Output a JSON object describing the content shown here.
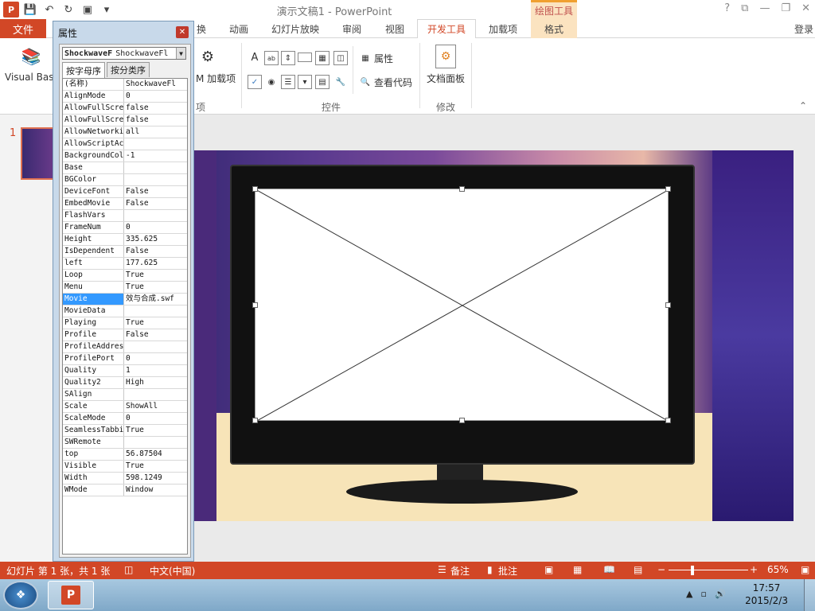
{
  "app": {
    "title": "演示文稿1 - PowerPoint",
    "context_tool": "绘图工具",
    "login": "登录",
    "window_controls": [
      "?",
      "⧉",
      "—",
      "❐",
      "✕"
    ]
  },
  "tabs": [
    {
      "label": "文件",
      "name": "file"
    },
    {
      "label": "换",
      "name": "transitions"
    },
    {
      "label": "动画",
      "name": "animations"
    },
    {
      "label": "幻灯片放映",
      "name": "slideshow"
    },
    {
      "label": "审阅",
      "name": "review"
    },
    {
      "label": "视图",
      "name": "view"
    },
    {
      "label": "开发工具",
      "name": "developer"
    },
    {
      "label": "加载项",
      "name": "addins"
    },
    {
      "label": "格式",
      "name": "format"
    }
  ],
  "ribbon": {
    "visual_basic": "Visual Bas",
    "addins_btn": "M 加载项",
    "group_addins_label": "项",
    "properties_btn": "属性",
    "view_code_btn": "查看代码",
    "group_controls_label": "控件",
    "doc_panel_btn": "文档面板",
    "group_modify_label": "修改"
  },
  "slides_panel": {
    "slide_number": "1"
  },
  "properties_window": {
    "title": "属性",
    "object_name": "ShockwaveF",
    "object_type": "ShockwaveFl",
    "tabs": [
      "按字母序",
      "按分类序"
    ],
    "rows": [
      [
        "(名称)",
        "ShockwaveFl"
      ],
      [
        "AlignMode",
        "0"
      ],
      [
        "AllowFullScre",
        "false"
      ],
      [
        "AllowFullScre",
        "false"
      ],
      [
        "AllowNetworki",
        "all"
      ],
      [
        "AllowScriptAc",
        ""
      ],
      [
        "BackgroundCol",
        "-1"
      ],
      [
        "Base",
        ""
      ],
      [
        "BGColor",
        ""
      ],
      [
        "DeviceFont",
        "False"
      ],
      [
        "EmbedMovie",
        "False"
      ],
      [
        "FlashVars",
        ""
      ],
      [
        "FrameNum",
        "0"
      ],
      [
        "Height",
        "335.625"
      ],
      [
        "IsDependent",
        "False"
      ],
      [
        "left",
        "177.625"
      ],
      [
        "Loop",
        "True"
      ],
      [
        "Menu",
        "True"
      ],
      [
        "Movie",
        "效与合成.swf"
      ],
      [
        "MovieData",
        ""
      ],
      [
        "Playing",
        "True"
      ],
      [
        "Profile",
        "False"
      ],
      [
        "ProfileAddres",
        ""
      ],
      [
        "ProfilePort",
        "0"
      ],
      [
        "Quality",
        "1"
      ],
      [
        "Quality2",
        "High"
      ],
      [
        "SAlign",
        ""
      ],
      [
        "Scale",
        "ShowAll"
      ],
      [
        "ScaleMode",
        "0"
      ],
      [
        "SeamlessTabbi",
        "True"
      ],
      [
        "SWRemote",
        ""
      ],
      [
        "top",
        "56.87504"
      ],
      [
        "Visible",
        "True"
      ],
      [
        "Width",
        "598.1249"
      ],
      [
        "WMode",
        "Window"
      ]
    ],
    "selected_row": "Movie"
  },
  "status": {
    "slide_info": "幻灯片 第 1 张，共 1 张",
    "language": "中文(中国)",
    "notes": "备注",
    "comments": "批注",
    "zoom": "65%"
  },
  "taskbar": {
    "time": "17:57",
    "date": "2015/2/3"
  },
  "colors": {
    "accent": "#d24726",
    "selection": "#3399ff"
  }
}
